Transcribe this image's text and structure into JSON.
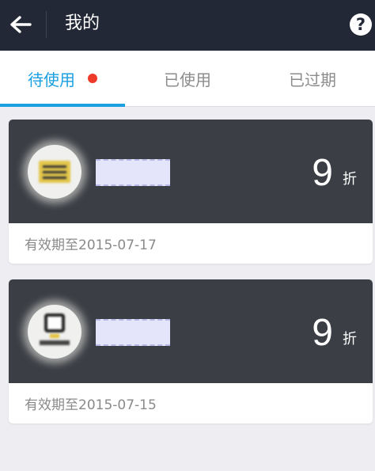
{
  "header": {
    "title": "我的",
    "back_icon": "arrow-left-icon",
    "help_label": "?"
  },
  "tabs": [
    {
      "label": "待使用",
      "active": true,
      "has_dot": true
    },
    {
      "label": "已使用",
      "active": false
    },
    {
      "label": "已过期",
      "active": false
    }
  ],
  "coupons": [
    {
      "discount_value": "9",
      "discount_unit": "折",
      "expiry": "有效期至2015-07-17"
    },
    {
      "discount_value": "9",
      "discount_unit": "折",
      "expiry": "有效期至2015-07-15"
    }
  ],
  "colors": {
    "header_bg": "#222835",
    "accent": "#1a9fe0",
    "dot": "#ee3a2a",
    "card_dark": "#3b3e44"
  }
}
